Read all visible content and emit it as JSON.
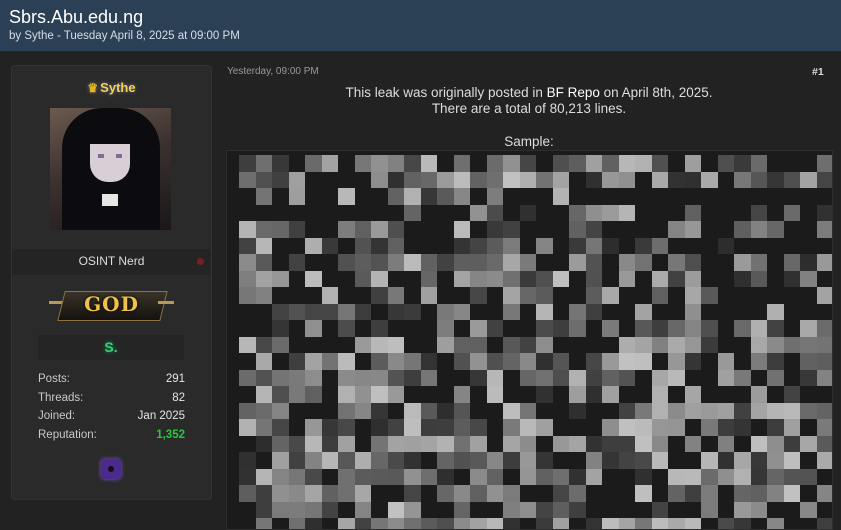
{
  "thread": {
    "title": "Sbrs.Abu.edu.ng",
    "byline": "by Sythe - Tuesday April 8, 2025 at 09:00 PM"
  },
  "user": {
    "username": "Sythe",
    "user_title": "OSINT Nerd",
    "rank": "GOD",
    "award": "S.",
    "stats": [
      {
        "label": "Posts:",
        "value": "291"
      },
      {
        "label": "Threads:",
        "value": "82"
      },
      {
        "label": "Joined:",
        "value": "Jan 2025"
      },
      {
        "label": "Reputation:",
        "value": "1,352"
      }
    ],
    "icons": {
      "crown": "crown-icon",
      "status": "offline-status-dot",
      "badge": "purple-badge-icon"
    }
  },
  "post": {
    "timestamp": "Yesterday, 09:00 PM",
    "number": "#1",
    "line1_pre": "This leak was originally posted in ",
    "line1_link": "BF Repo",
    "line1_post": " on April 8th, 2025.",
    "line2": "There are a total of 80,213 lines.",
    "sample_label": "Sample:"
  },
  "colors": {
    "header_bg": "#2b3f55",
    "page_bg": "#222222",
    "username": "#f2d15a",
    "rank_gold": "#f0c24a",
    "reputation_green": "#27c840"
  }
}
